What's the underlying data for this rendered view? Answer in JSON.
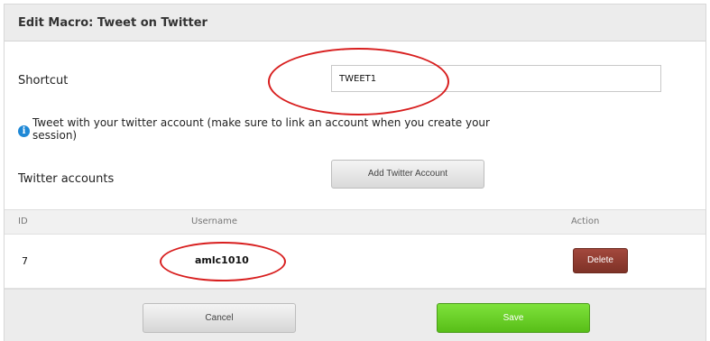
{
  "dialog": {
    "title": "Edit Macro: Tweet on Twitter"
  },
  "form": {
    "shortcut_label": "Shortcut",
    "shortcut_value": "TWEET1",
    "info_text": "Tweet with your twitter account (make sure to link an account when you create your session)",
    "info_icon": "info-icon",
    "accounts_label": "Twitter accounts",
    "add_account_label": "Add Twitter Account"
  },
  "table": {
    "headers": {
      "id": "ID",
      "username": "Username",
      "action": "Action"
    },
    "rows": [
      {
        "id": "7",
        "username": "amlc1010",
        "action_label": "Delete"
      }
    ]
  },
  "footer": {
    "cancel_label": "Cancel",
    "save_label": "Save"
  },
  "colors": {
    "annotation": "#d81f1f",
    "save": "#5cc21c",
    "delete": "#8f3c31",
    "info": "#1e88d6"
  }
}
